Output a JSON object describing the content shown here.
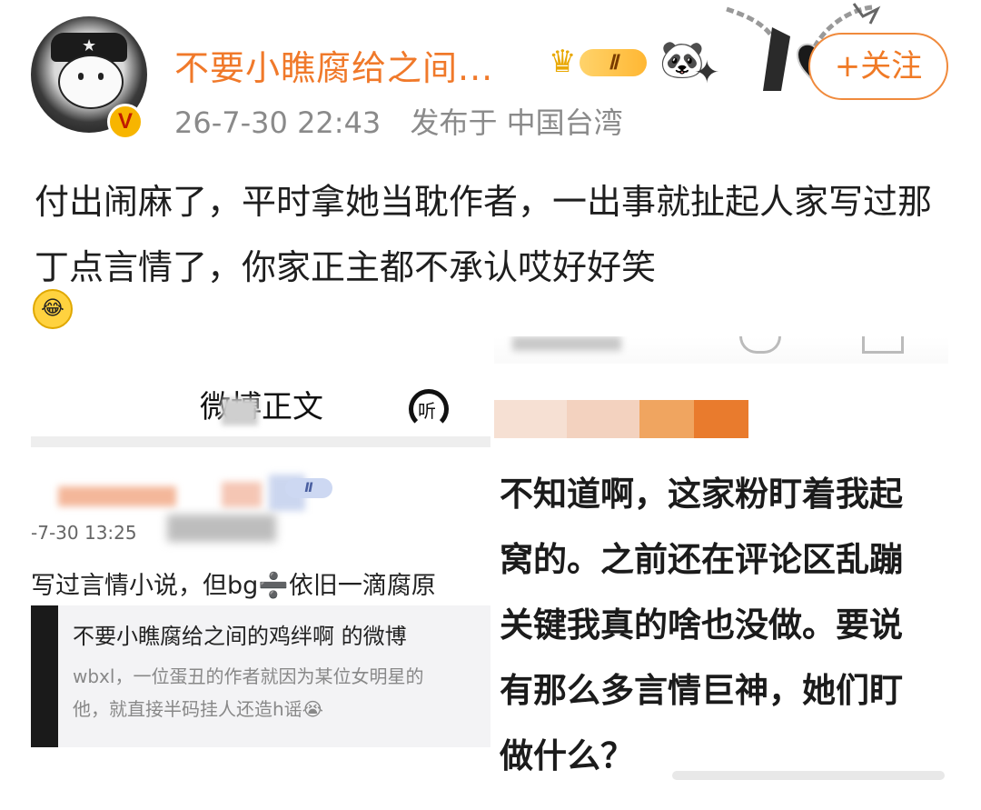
{
  "header": {
    "username": "不要小瞧腐给之间...",
    "vip_level": "Ⅱ",
    "verified_badge": "V",
    "follow_label": "+关注",
    "time": "26-7-30 22:43",
    "posted_from": "发布于 中国台湾"
  },
  "post": {
    "text": "付出闹麻了，平时拿她当耽作者，一出事就扯起人家写过那丁点言情了，你家正主都不承认哎好好笑",
    "emoji": "😂"
  },
  "left_screenshot": {
    "header_title": "微博正文",
    "listen_label": "听",
    "vip_level": "Ⅱ",
    "time": "-7-30 13:25",
    "line1": "写过言情小说，但bg➗依旧一滴腐原",
    "quote_title": "不要小瞧腐给之间的鸡绊啊 的微博",
    "quote_line1": "wbxl，一位蛋丑的作者就因为某位女明星的",
    "quote_line2": "他，就直接半码挂人还造h谣😭"
  },
  "right_screenshot": {
    "lines": [
      "不知道啊，这家粉盯着我起",
      "窝的。之前还在评论区乱蹦",
      "关键我真的啥也没做。要说",
      "有那么多言情巨神，她们盯",
      "做什么？"
    ]
  },
  "colors": {
    "username": "#f0792a",
    "follow": "#f07a26",
    "meta": "#8a8a8a"
  }
}
